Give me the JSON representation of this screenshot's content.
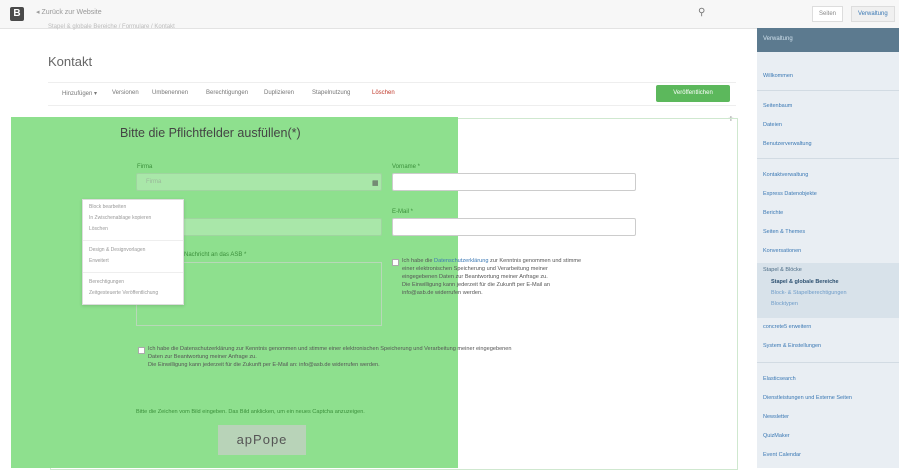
{
  "topbar": {
    "logo": "B",
    "back_link": "◂ Zurück zur Website",
    "buttons": [
      "Seiten",
      "Verwaltung"
    ]
  },
  "breadcrumb": "Stapel & globale Bereiche  /  Formulare  /  Kontakt",
  "page_title": "Kontakt",
  "toolbar": {
    "items": [
      "Hinzufügen ▾",
      "Versionen",
      "Umbenennen",
      "Berechtigungen",
      "Duplizieren",
      "Stapelnutzung",
      "Löschen"
    ],
    "publish": "Veröffentlichen"
  },
  "form": {
    "title": "Bitte die Pflichtfelder ausfüllen(*)",
    "firma_label": "Firma",
    "firma_placeholder": "Firma",
    "vorname_label": "Vorname *",
    "email_label": "E-Mail *",
    "message_label": "Nachricht an das ASB *",
    "right_consent": [
      "Ich habe die",
      "Datenschutzerklärung",
      " zur Kenntnis genommen und stimme",
      "einer elektronischen Speicherung und Verarbeitung meiner",
      "eingegebenen Daten zur Beantwortung meiner Anfrage zu.",
      "Die Einwilligung kann jederzeit für die Zukunft per E-Mail an",
      "info@asb.de widerrufen werden."
    ],
    "bottom_consent": [
      "Ich habe die Datenschutzerklärung zur Kenntnis genommen und stimme einer elektronischen Speicherung und Verarbeitung meiner eingegebenen",
      "Daten zur Beantwortung meiner Anfrage zu.",
      "Die Einwilligung kann jederzeit für die Zukunft per E-Mail an: info@asb.de widerrufen werden."
    ],
    "captcha_text": "Bitte die Zeichen vom Bild eingeben. Das Bild anklicken, um ein neues Captcha anzuzeigen.",
    "captcha_code": "apPope"
  },
  "context_menu": {
    "items": [
      "Block bearbeiten",
      "In Zwischenablage kopieren",
      "Löschen",
      "Design & Designvorlagen",
      "Erweitert",
      "Berechtigungen",
      "Zeitgesteuerte Veröffentlichung"
    ]
  },
  "sidebar": {
    "header": "Verwaltung",
    "items": [
      "Willkommen",
      "Seitenbaum",
      "Dateien",
      "Benutzerverwaltung",
      "Kontaktverwaltung",
      "Express Datenobjekte",
      "Berichte",
      "Seiten & Themes",
      "Konversationen",
      "Stapel & Blöcke",
      "concrete5 erweitern",
      "System & Einstellungen",
      "Elasticsearch",
      "Dienstleistungen und Externe Seiten",
      "Newsletter",
      "QuizMaker",
      "Event Calendar"
    ],
    "subitems": [
      "Stapel & globale Bereiche",
      "Block- & Stapelberechtigungen",
      "Blocktypen"
    ]
  },
  "colors": {
    "highlight": "#8ee08e",
    "publish": "#5cb85c",
    "sidebar_header": "#5c7a8f",
    "link": "#3a78b4"
  }
}
